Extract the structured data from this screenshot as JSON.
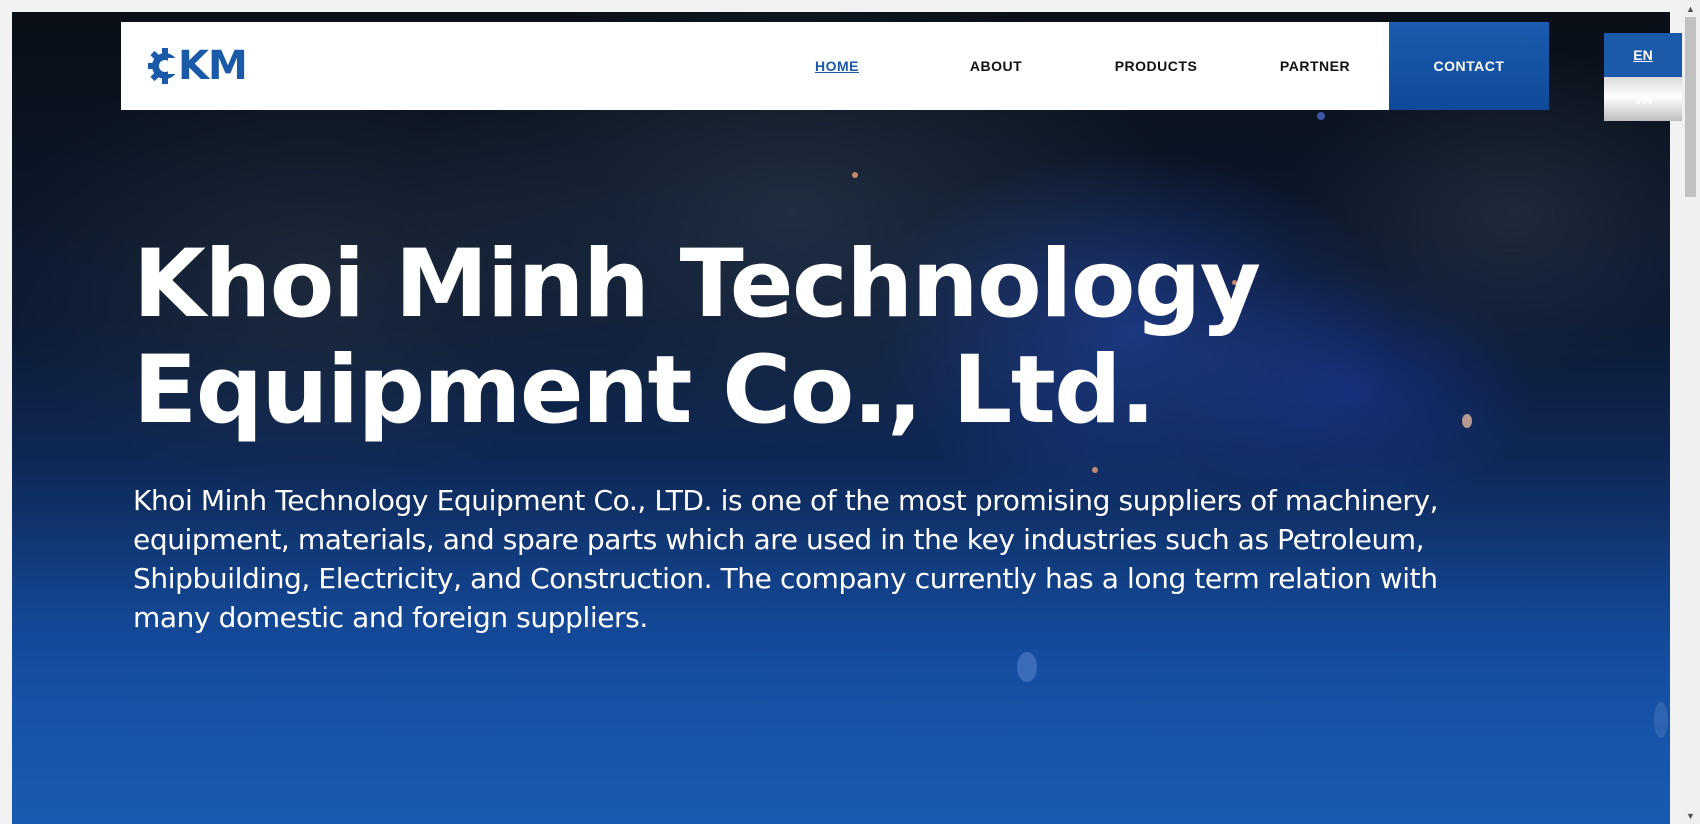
{
  "brand": {
    "logo_text": "KM",
    "accent_color": "#1a5aa8"
  },
  "nav": {
    "home": "HOME",
    "about": "ABOUT",
    "products": "PRODUCTS",
    "partner": "PARTNER",
    "contact": "CONTACT"
  },
  "language": {
    "en": "EN",
    "vn": "VN",
    "selected": "EN"
  },
  "hero": {
    "title_line1": "Khoi Minh Technology",
    "title_line2": "Equipment Co., Ltd.",
    "description": "Khoi Minh Technology Equipment Co., LTD. is one of the most promising suppliers of machinery, equipment, materials, and spare parts which are used in the key industries such as Petroleum, Shipbuilding, Electricity, and Construction. The company currently has a long term relation with many domestic and foreign suppliers."
  },
  "icons": {
    "logo_gear": "gear-icon",
    "scroll_up": "chevron-up-icon",
    "scroll_down": "chevron-down-icon"
  }
}
